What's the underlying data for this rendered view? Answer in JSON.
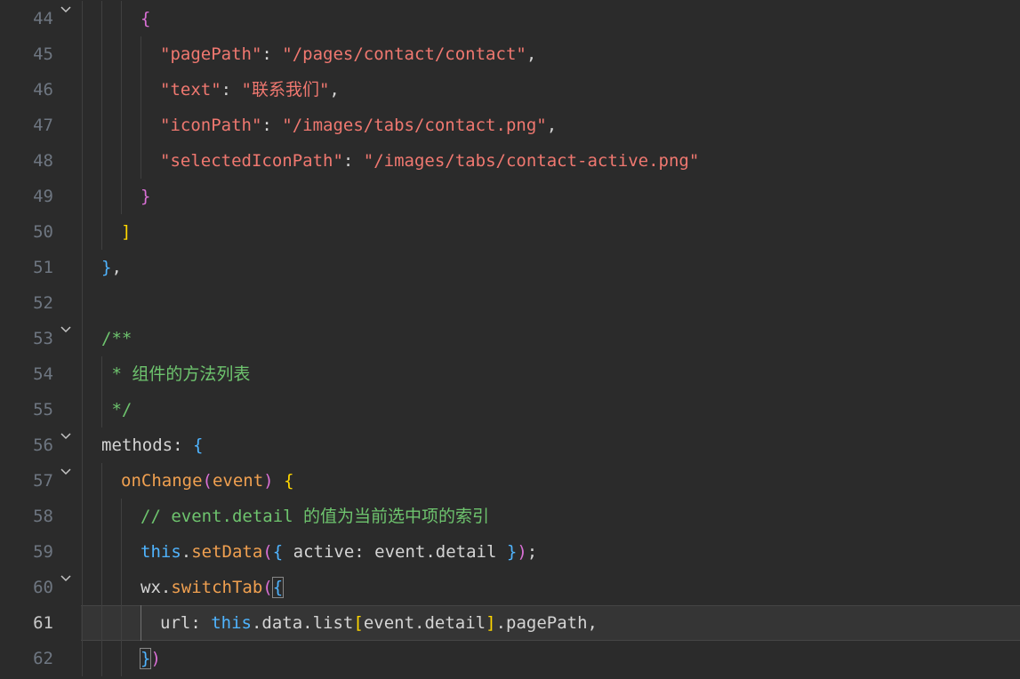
{
  "editor": {
    "current_line": "61",
    "lines": [
      {
        "num": "44",
        "fold": true,
        "tokens": [
          {
            "t": "{",
            "c": "t-b1"
          }
        ]
      },
      {
        "num": "45",
        "fold": false,
        "tokens": [
          {
            "t": "\"pagePath\"",
            "c": "t-key"
          },
          {
            "t": ": ",
            "c": "t-punc"
          },
          {
            "t": "\"/pages/contact/contact\"",
            "c": "t-str"
          },
          {
            "t": ",",
            "c": "t-punc"
          }
        ]
      },
      {
        "num": "46",
        "fold": false,
        "tokens": [
          {
            "t": "\"text\"",
            "c": "t-key"
          },
          {
            "t": ": ",
            "c": "t-punc"
          },
          {
            "t": "\"联系我们\"",
            "c": "t-str"
          },
          {
            "t": ",",
            "c": "t-punc"
          }
        ]
      },
      {
        "num": "47",
        "fold": false,
        "tokens": [
          {
            "t": "\"iconPath\"",
            "c": "t-key"
          },
          {
            "t": ": ",
            "c": "t-punc"
          },
          {
            "t": "\"/images/tabs/contact.png\"",
            "c": "t-str"
          },
          {
            "t": ",",
            "c": "t-punc"
          }
        ]
      },
      {
        "num": "48",
        "fold": false,
        "tokens": [
          {
            "t": "\"selectedIconPath\"",
            "c": "t-key"
          },
          {
            "t": ": ",
            "c": "t-punc"
          },
          {
            "t": "\"/images/tabs/contact-active.png\"",
            "c": "t-str"
          }
        ]
      },
      {
        "num": "49",
        "fold": false,
        "tokens": [
          {
            "t": "}",
            "c": "t-b1"
          }
        ]
      },
      {
        "num": "50",
        "fold": false,
        "tokens": [
          {
            "t": "]",
            "c": "t-b2"
          }
        ]
      },
      {
        "num": "51",
        "fold": false,
        "tokens": [
          {
            "t": "}",
            "c": "t-b3"
          },
          {
            "t": ",",
            "c": "t-punc"
          }
        ]
      },
      {
        "num": "52",
        "fold": false,
        "tokens": []
      },
      {
        "num": "53",
        "fold": true,
        "tokens": [
          {
            "t": "/**",
            "c": "t-com"
          }
        ]
      },
      {
        "num": "54",
        "fold": false,
        "tokens": [
          {
            "t": " * 组件的方法列表",
            "c": "t-com"
          }
        ]
      },
      {
        "num": "55",
        "fold": false,
        "tokens": [
          {
            "t": " */",
            "c": "t-com"
          }
        ]
      },
      {
        "num": "56",
        "fold": true,
        "tokens": [
          {
            "t": "methods",
            "c": "t-id"
          },
          {
            "t": ": ",
            "c": "t-punc"
          },
          {
            "t": "{",
            "c": "t-b3"
          }
        ]
      },
      {
        "num": "57",
        "fold": true,
        "tokens": [
          {
            "t": "onChange",
            "c": "t-fn"
          },
          {
            "t": "(",
            "c": "t-b1"
          },
          {
            "t": "event",
            "c": "t-param"
          },
          {
            "t": ")",
            "c": "t-b1"
          },
          {
            "t": " ",
            "c": "t-punc"
          },
          {
            "t": "{",
            "c": "t-b2"
          }
        ]
      },
      {
        "num": "58",
        "fold": false,
        "tokens": [
          {
            "t": "// event.detail 的值为当前选中项的索引",
            "c": "t-com"
          }
        ]
      },
      {
        "num": "59",
        "fold": false,
        "tokens": [
          {
            "t": "this",
            "c": "t-this"
          },
          {
            "t": ".",
            "c": "t-punc"
          },
          {
            "t": "setData",
            "c": "t-fn"
          },
          {
            "t": "(",
            "c": "t-b1"
          },
          {
            "t": "{",
            "c": "t-b3"
          },
          {
            "t": " active: event.detail ",
            "c": "t-id"
          },
          {
            "t": "}",
            "c": "t-b3"
          },
          {
            "t": ")",
            "c": "t-b1"
          },
          {
            "t": ";",
            "c": "t-punc"
          }
        ]
      },
      {
        "num": "60",
        "fold": true,
        "tokens": [
          {
            "t": "wx",
            "c": "t-id"
          },
          {
            "t": ".",
            "c": "t-punc"
          },
          {
            "t": "switchTab",
            "c": "t-fn"
          },
          {
            "t": "(",
            "c": "t-b1"
          },
          {
            "t": "{",
            "c": "t-b3 bracket-hl"
          }
        ]
      },
      {
        "num": "61",
        "fold": false,
        "tokens": [
          {
            "t": "url",
            "c": "t-id"
          },
          {
            "t": ": ",
            "c": "t-punc"
          },
          {
            "t": "this",
            "c": "t-this"
          },
          {
            "t": ".data.list",
            "c": "t-id"
          },
          {
            "t": "[",
            "c": "t-b2"
          },
          {
            "t": "event.detail",
            "c": "t-id"
          },
          {
            "t": "]",
            "c": "t-b2"
          },
          {
            "t": ".pagePath,",
            "c": "t-id"
          }
        ]
      },
      {
        "num": "62",
        "fold": false,
        "tokens": [
          {
            "t": "}",
            "c": "t-b3 bracket-hl"
          },
          {
            "t": ")",
            "c": "t-b1"
          }
        ]
      }
    ]
  }
}
